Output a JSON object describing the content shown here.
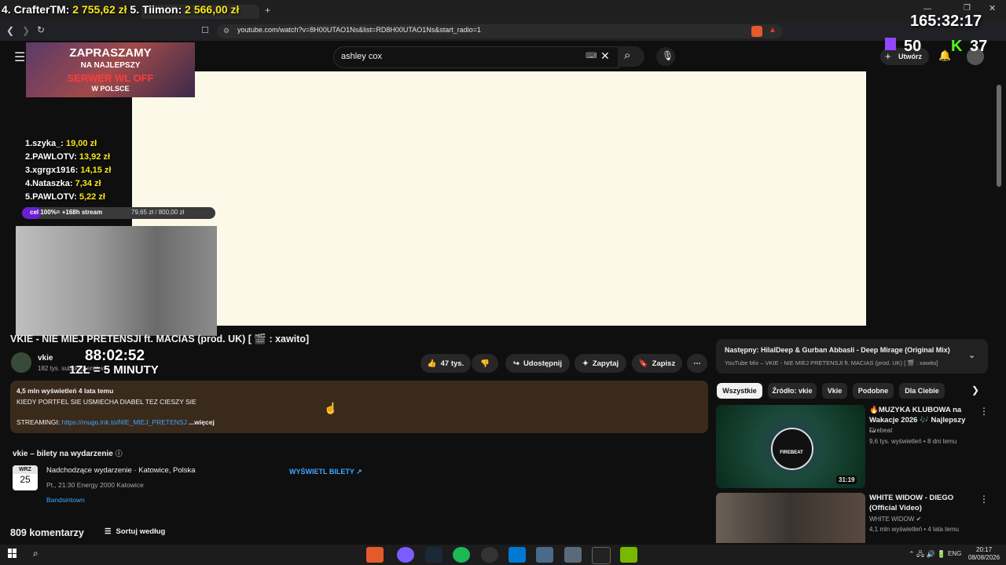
{
  "browser": {
    "url": "youtube.com/watch?v=8H00UTAO1Ns&list=RD8H00UTAO1Ns&start_radio=1"
  },
  "stream_overlay": {
    "ticker": {
      "prefix": "4. CrafterTM: ",
      "amount1": "2 755,62 zł",
      "mid": " 5. Tiimon: ",
      "amount2": "2 566,00 zł"
    },
    "timer": "165:32:17",
    "twitch_count": "50",
    "kick_count": "37",
    "banner": {
      "line1": "ZAPRASZAMY",
      "line2": "NA NAJLEPSZY",
      "line3": "SERWER WL OFF",
      "line4": "W POLSCE"
    },
    "donors": [
      {
        "name": "1.szyka_: ",
        "amount": "19,00 zł"
      },
      {
        "name": "2.PAWLOTV: ",
        "amount": "13,92 zł"
      },
      {
        "name": "3.xgrgx1916: ",
        "amount": "14,15 zł"
      },
      {
        "name": "4.Nataszka: ",
        "amount": "7,34 zł"
      },
      {
        "name": "5.PAWLOTV: ",
        "amount": "5,22 zł"
      }
    ],
    "goal_label": "cel 100%= +168h stream",
    "goal_amount": "79,65 zł / 800,00 zł",
    "countdown": "88:02:52",
    "rate": "1ZŁ = 5 MINUTY"
  },
  "youtube": {
    "search_value": "ashley cox",
    "create_label": "Utwórz",
    "video_title": "VKIE - NIE MIEJ PRETENSJI ft. MACIAS (prod. UK) [ 🎬 : xawito]",
    "channel": "vkie",
    "subscribers": "182 tys. subskrybentów",
    "likes": "47 tys.",
    "share": "Udostępnij",
    "ask": "Zapytaj",
    "save": "Zapisz",
    "description": {
      "stats": "4,5 mln wyświetleń  4 lata temu",
      "line1": "KIEDY PORTFEL SIE USMIECHA DIABEL TEZ CIESZY SIE",
      "streaming_label": "STREAMINGI: ",
      "streaming_link": "https://mugo.lnk.to/NIE_MIEJ_PRETENSJ",
      "more": "...więcej"
    },
    "tickets": {
      "heading": "vkie – bilety na wydarzenie",
      "month": "WRZ",
      "day": "25",
      "event": "Nadchodzące wydarzenie · Katowice, Polska",
      "details": "Pt., 21:30 Energy 2000 Katowice",
      "provider": "Bandsintown",
      "button": "WYŚWIETL BILETY ↗"
    },
    "comments_count": "809 komentarzy",
    "sort_label": "Sortuj według",
    "next": {
      "title": "Następny: HilalDeep & Gurban Abbasli - Deep Mirage (Original Mix)",
      "subtitle": "YouTube Mix – VKIE - NIE MIEJ PRETENSJI ft. MACIAS (prod. UK) [ 🎬 : xawito]"
    },
    "chips": [
      "Wszystkie",
      "Źródło: vkie",
      "Vkie",
      "Podobne",
      "Dla Ciebie"
    ],
    "recommendations": [
      {
        "title": "🔥MUZYKA KLUBOWA na Wakacje 2026 🎶 Najlepszy ...",
        "channel": "Firebeat",
        "meta": "9,6 tys. wyświetleń • 8 dni temu",
        "duration": "31:19",
        "thumb_label": "FIREBEAT"
      },
      {
        "title": "WHITE WIDOW - DIEGO (Official Video)",
        "channel": "WHITE WIDOW",
        "meta": "4,1 mln wyświetleń • 4 lata temu"
      }
    ]
  },
  "taskbar": {
    "lang": "ENG",
    "time": "20:17",
    "date": "08/08/2026"
  }
}
